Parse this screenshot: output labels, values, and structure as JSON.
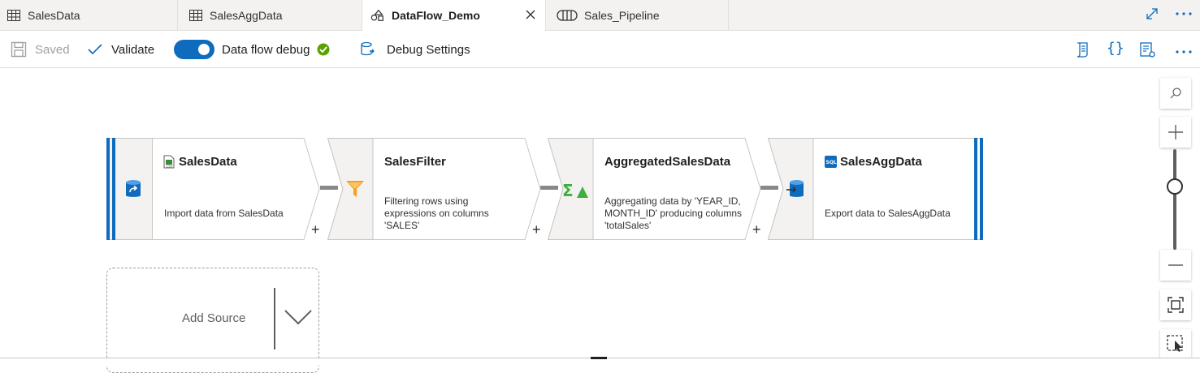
{
  "tabs": [
    {
      "label": "SalesData",
      "icon": "table-icon"
    },
    {
      "label": "SalesAggData",
      "icon": "table-icon"
    },
    {
      "label": "DataFlow_Demo",
      "icon": "dataflow-icon",
      "active": true
    },
    {
      "label": "Sales_Pipeline",
      "icon": "pipeline-icon"
    }
  ],
  "toolbar": {
    "saved_label": "Saved",
    "validate_label": "Validate",
    "debug_label": "Data flow debug",
    "debug_enabled": true,
    "debug_settings_label": "Debug Settings"
  },
  "nodes": [
    {
      "title": "SalesData",
      "description": "Import data from SalesData",
      "icon": "source-db-icon",
      "title_icon": "dataset-file-icon"
    },
    {
      "title": "SalesFilter",
      "description": "Filtering rows using expressions on columns 'SALES'",
      "icon": "filter-icon"
    },
    {
      "title": "AggregatedSalesData",
      "description": "Aggregating data by 'YEAR_ID, MONTH_ID' producing columns 'totalSales'",
      "icon": "aggregate-icon"
    },
    {
      "title": "SalesAggData",
      "description": "Export data to SalesAggData",
      "icon": "sink-db-icon",
      "title_icon": "sql-dataset-icon"
    }
  ],
  "add_source": {
    "label": "Add Source"
  },
  "colors": {
    "accent": "#0f6cbd",
    "success": "#57a300",
    "filter": "#f7a21b",
    "aggregate": "#3eae3e"
  }
}
